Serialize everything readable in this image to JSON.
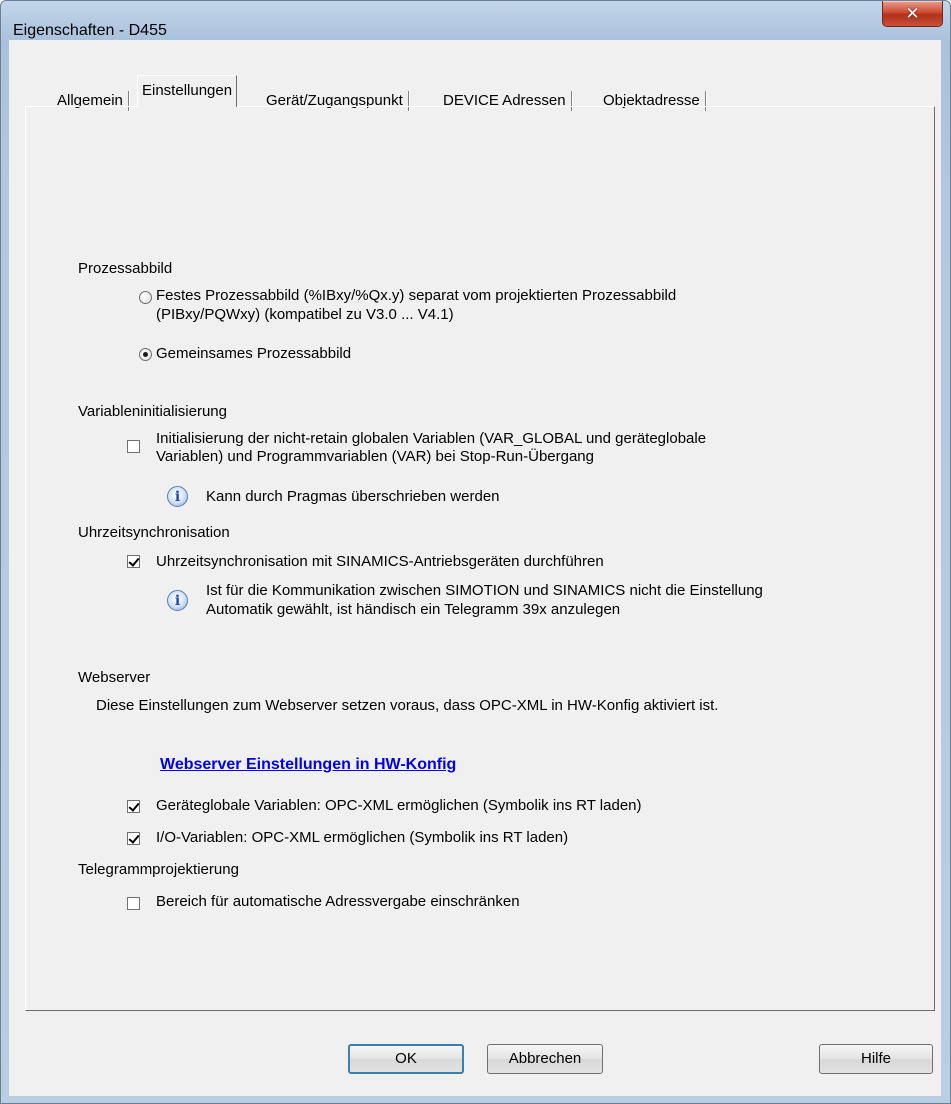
{
  "window": {
    "title": "Eigenschaften - D455",
    "close_icon": "close-icon"
  },
  "tabs": [
    {
      "label": "Allgemein"
    },
    {
      "label": "Einstellungen"
    },
    {
      "label": "Gerät/Zugangspunkt"
    },
    {
      "label": "DEVICE Adressen"
    },
    {
      "label": "Objektadresse"
    }
  ],
  "prozessabbild": {
    "heading": "Prozessabbild",
    "option1_line1": "Festes Prozessabbild (%IBxy/%Qx.y) separat vom projektierten Prozessabbild",
    "option1_line2": "(PIBxy/PQWxy) (kompatibel zu V3.0 ... V4.1)",
    "option2": "Gemeinsames Prozessabbild",
    "selected": 2
  },
  "variableninit": {
    "heading": "Variableninitialisierung",
    "checkbox_line1": "Initialisierung der nicht-retain globalen Variablen (VAR_GLOBAL und geräteglobale",
    "checkbox_line2": "Variablen) und Programmvariablen (VAR) bei Stop-Run-Übergang",
    "checked": false,
    "info": "Kann durch Pragmas überschrieben werden"
  },
  "uhrzeit": {
    "heading": "Uhrzeitsynchronisation",
    "checkbox": "Uhrzeitsynchronisation mit SINAMICS-Antriebsgeräten durchführen",
    "checked": true,
    "info_line1": "Ist für die Kommunikation zwischen SIMOTION und SINAMICS nicht die Einstellung",
    "info_line2": "Automatik gewählt, ist händisch ein Telegramm 39x anzulegen"
  },
  "webserver": {
    "heading": "Webserver",
    "description": "Diese Einstellungen zum Webserver setzen voraus, dass OPC-XML in HW-Konfig aktiviert ist.",
    "link": "Webserver Einstellungen in HW-Konfig",
    "checkbox1": "Geräteglobale Variablen: OPC-XML ermöglichen (Symbolik ins RT laden)",
    "checkbox1_checked": true,
    "checkbox2": "I/O-Variablen: OPC-XML ermöglichen (Symbolik ins RT laden)",
    "checkbox2_checked": true
  },
  "telegramm": {
    "heading": "Telegrammprojektierung",
    "checkbox": "Bereich für automatische Adressvergabe einschränken",
    "checked": false
  },
  "buttons": {
    "ok": "OK",
    "cancel": "Abbrechen",
    "help": "Hilfe"
  }
}
